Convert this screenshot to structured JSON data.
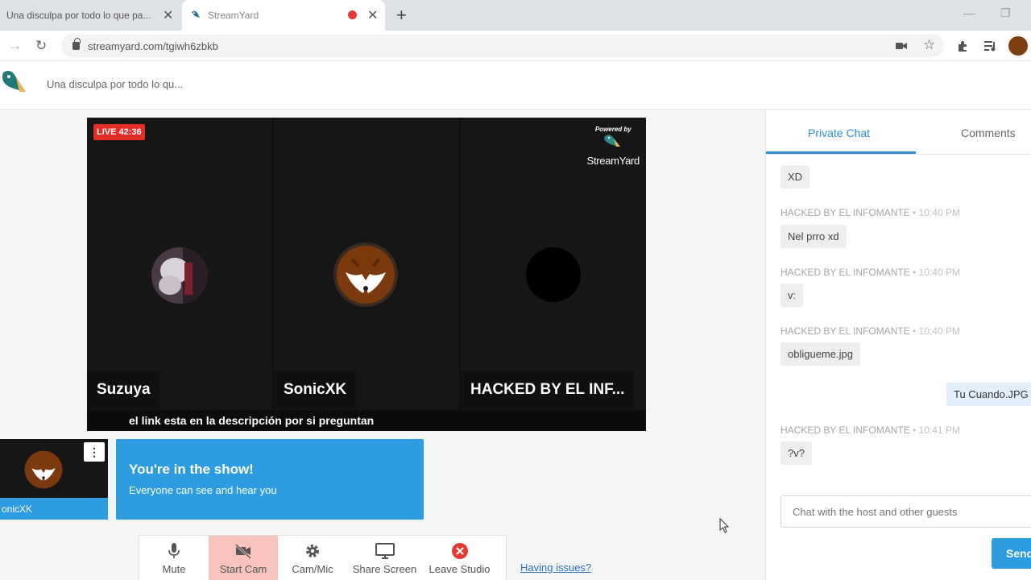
{
  "browser": {
    "tabs": [
      {
        "title": "Una disculpa por todo lo que pa...",
        "close": "✕"
      },
      {
        "title": "StreamYard",
        "close": "✕"
      }
    ],
    "new_tab": "+",
    "url": "streamyard.com/tgiwh6zbkb"
  },
  "app": {
    "broadcast_title": "Una disculpa por todo lo qu..."
  },
  "stage": {
    "live_badge": "LIVE 42:36",
    "powered_by": "Powered by",
    "powered_name": "StreamYard",
    "participants": [
      {
        "name": "Suzuya"
      },
      {
        "name": "SonicXK"
      },
      {
        "name": "HACKED BY EL INF..."
      }
    ],
    "banner": "el link esta en la descripción por si preguntan"
  },
  "self_preview": {
    "name": "onicXK",
    "menu": "⋮"
  },
  "show_card": {
    "title": "You're in the show!",
    "subtitle": "Everyone can see and hear you"
  },
  "controls": [
    {
      "label": "Mute",
      "icon": "microphone-icon"
    },
    {
      "label": "Start Cam",
      "icon": "camera-off-icon"
    },
    {
      "label": "Cam/Mic",
      "icon": "gear-icon"
    },
    {
      "label": "Share Screen",
      "icon": "monitor-icon"
    },
    {
      "label": "Leave Studio",
      "icon": "close-circle-icon"
    }
  ],
  "having_issues": "Having issues?",
  "chat": {
    "tabs": [
      "Private Chat",
      "Comments"
    ],
    "messages": [
      {
        "text": "XD"
      },
      {
        "author": "HACKED BY EL INFOMANTE",
        "time": "10:40 PM",
        "text": "Nel prro xd"
      },
      {
        "author": "HACKED BY EL INFOMANTE",
        "time": "10:40 PM",
        "text": "v:"
      },
      {
        "author": "HACKED BY EL INFOMANTE",
        "time": "10:40 PM",
        "text": "obligueme.jpg"
      },
      {
        "text": "Tu Cuando.JPG",
        "mine": true
      },
      {
        "author": "HACKED BY EL INFOMANTE",
        "time": "10:41 PM",
        "text": "?v?"
      }
    ],
    "input_placeholder": "Chat with the host and other guests",
    "send_label": "Send",
    "colors": {
      "accent": "#2d9ce0",
      "live": "#e52d27"
    }
  }
}
